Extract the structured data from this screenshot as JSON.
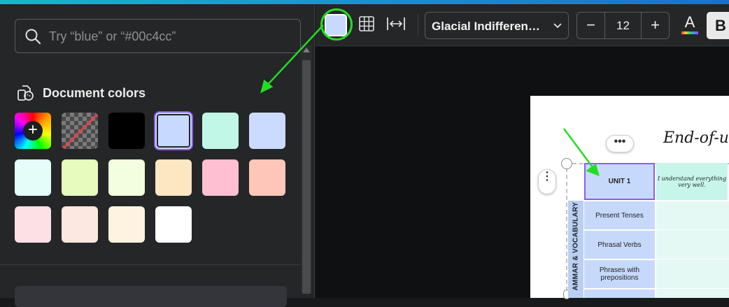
{
  "search": {
    "placeholder": "Try “blue” or “#00c4cc”"
  },
  "document_colors": {
    "label": "Document colors",
    "swatches": [
      {
        "type": "add",
        "name": "add-color"
      },
      {
        "type": "transparent",
        "name": "no-color"
      },
      {
        "color": "#000000"
      },
      {
        "color": "#c8d9ff",
        "selected": true
      },
      {
        "color": "#c0f7e7"
      },
      {
        "color": "#cbdbff"
      },
      {
        "color": "#e4fdf8"
      },
      {
        "color": "#e7fbbf"
      },
      {
        "color": "#f3fde0"
      },
      {
        "color": "#fde6c2"
      },
      {
        "color": "#fdbfd1"
      },
      {
        "color": "#fdc6b8"
      },
      {
        "color": "#fde0e6"
      },
      {
        "color": "#fde7e1"
      },
      {
        "color": "#fef3e0"
      },
      {
        "color": "#ffffff"
      }
    ]
  },
  "toolbar": {
    "text_color_swatch": "#c8d9ff",
    "font_name": "Glacial Indifferen…",
    "font_size": "12",
    "minus_label": "−",
    "plus_label": "+",
    "font_color_letter": "A",
    "bold_label": "B"
  },
  "canvas": {
    "more_label": "•••",
    "side_more_label": "⋮",
    "doc_title": "End-of-un",
    "table": {
      "header_cell": "UNIT 1",
      "column_header": "I understand everything very well.",
      "side_label": "AMMAR & VOCABULARY",
      "rows": [
        "Present Tenses",
        "Phrasal Verbs",
        "Phrases with prepositions"
      ]
    }
  },
  "annotations": {
    "highlight_color": "#22dd22"
  }
}
